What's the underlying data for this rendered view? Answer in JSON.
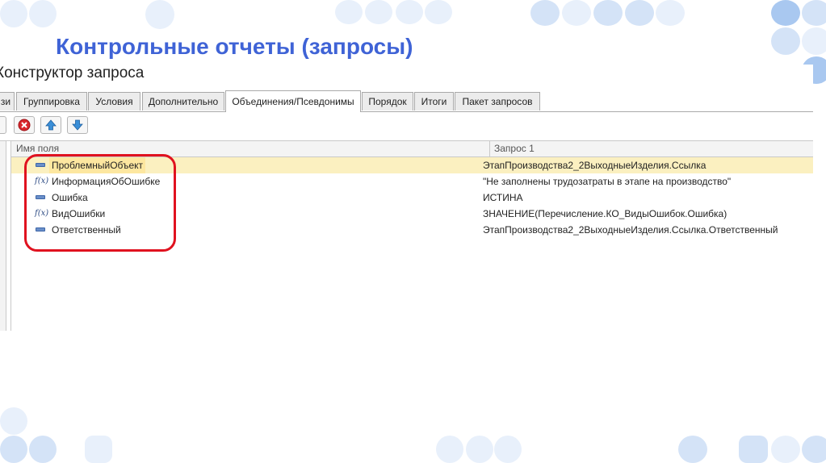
{
  "slide": {
    "title": "Контрольные отчеты (запросы)"
  },
  "window": {
    "title": "Конструктор запроса"
  },
  "tabs": [
    {
      "label": "зи",
      "active": false
    },
    {
      "label": "Группировка",
      "active": false
    },
    {
      "label": "Условия",
      "active": false
    },
    {
      "label": "Дополнительно",
      "active": false
    },
    {
      "label": "Объединения/Псевдонимы",
      "active": true
    },
    {
      "label": "Порядок",
      "active": false
    },
    {
      "label": "Итоги",
      "active": false
    },
    {
      "label": "Пакет запросов",
      "active": false
    }
  ],
  "toolbar": {
    "buttons": [
      {
        "icon": "delete-icon"
      },
      {
        "icon": "arrow-up-icon"
      },
      {
        "icon": "arrow-down-icon"
      }
    ]
  },
  "grid": {
    "columns": [
      "Имя поля",
      "Запрос 1"
    ],
    "rows": [
      {
        "icon": "field-icon",
        "name": "ПроблемныйОбъект",
        "value": "ЭтапПроизводства2_2ВыходныеИзделия.Ссылка",
        "selected": true
      },
      {
        "icon": "function-icon",
        "name": "ИнформацияОбОшибке",
        "value": "\"Не заполнены трудозатраты в этапе на производство\"",
        "selected": false
      },
      {
        "icon": "field-icon",
        "name": "Ошибка",
        "value": "ИСТИНА",
        "selected": false
      },
      {
        "icon": "function-icon",
        "name": "ВидОшибки",
        "value": "ЗНАЧЕНИЕ(Перечисление.КО_ВидыОшибок.Ошибка)",
        "selected": false
      },
      {
        "icon": "field-icon",
        "name": "Ответственный",
        "value": "ЭтапПроизводства2_2ВыходныеИзделия.Ссылка.Ответственный",
        "selected": false
      }
    ]
  },
  "colors": {
    "title": "#3f63d6",
    "highlight": "#e0121f",
    "selected_row": "#fbf0c0"
  }
}
